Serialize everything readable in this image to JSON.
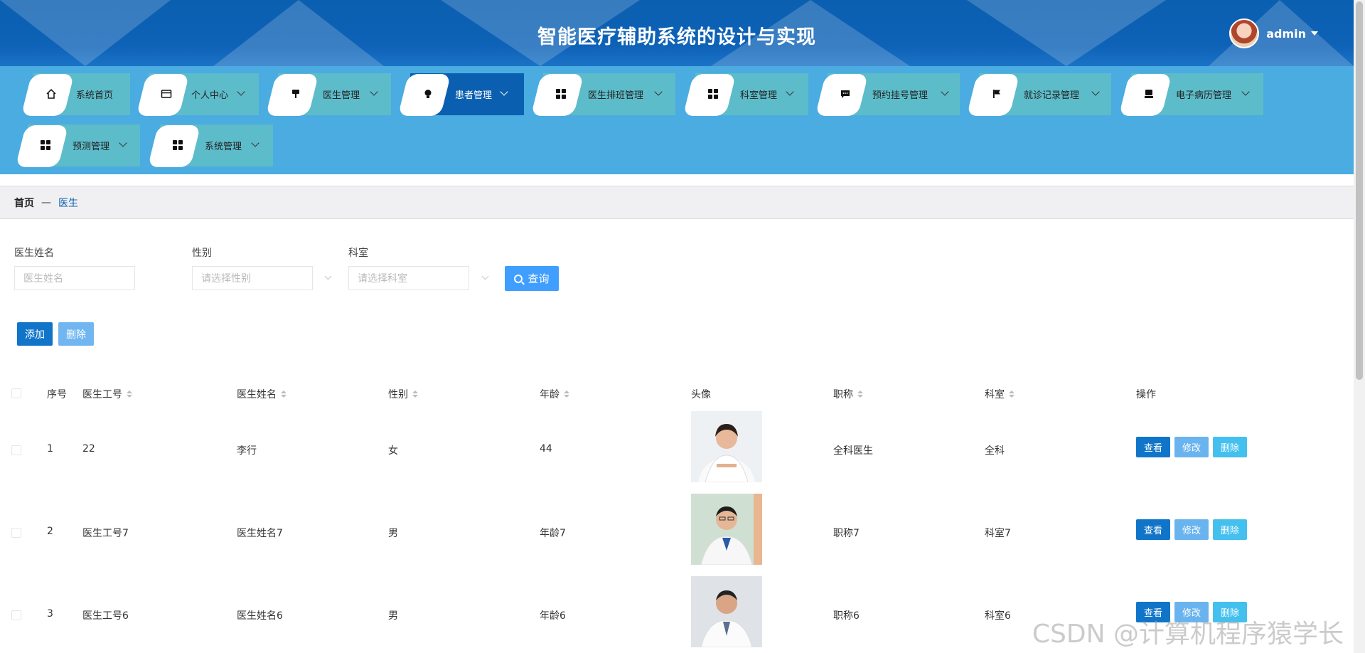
{
  "header": {
    "title": "智能医疗辅助系统的设计与实现",
    "username": "admin"
  },
  "nav": {
    "items": [
      {
        "label": "系统首页",
        "icon": "home-icon"
      },
      {
        "label": "个人中心",
        "icon": "card-icon"
      },
      {
        "label": "医生管理",
        "icon": "brush-icon"
      },
      {
        "label": "患者管理",
        "icon": "bulb-icon"
      },
      {
        "label": "医生排班管理",
        "icon": "grid-icon"
      },
      {
        "label": "科室管理",
        "icon": "grid-icon"
      },
      {
        "label": "预约挂号管理",
        "icon": "chat-icon"
      },
      {
        "label": "就诊记录管理",
        "icon": "flag-icon"
      },
      {
        "label": "电子病历管理",
        "icon": "printer-icon"
      },
      {
        "label": "预测管理",
        "icon": "grid-icon"
      },
      {
        "label": "系统管理",
        "icon": "grid-icon"
      }
    ]
  },
  "breadcrumb": {
    "home": "首页",
    "separator": "—",
    "current": "医生"
  },
  "search": {
    "name_label": "医生姓名",
    "name_placeholder": "医生姓名",
    "gender_label": "性别",
    "gender_placeholder": "请选择性别",
    "dept_label": "科室",
    "dept_placeholder": "请选择科室",
    "query_button": "查询"
  },
  "actions": {
    "add": "添加",
    "delete": "删除"
  },
  "table": {
    "columns": {
      "index": "序号",
      "doctor_id": "医生工号",
      "doctor_name": "医生姓名",
      "gender": "性别",
      "age": "年龄",
      "avatar": "头像",
      "title": "职称",
      "dept": "科室",
      "ops": "操作"
    },
    "rows": [
      {
        "index": "1",
        "doctor_id": "22",
        "doctor_name": "李行",
        "gender": "女",
        "age": "44",
        "title": "全科医生",
        "dept": "全科"
      },
      {
        "index": "2",
        "doctor_id": "医生工号7",
        "doctor_name": "医生姓名7",
        "gender": "男",
        "age": "年龄7",
        "title": "职称7",
        "dept": "科室7"
      },
      {
        "index": "3",
        "doctor_id": "医生工号6",
        "doctor_name": "医生姓名6",
        "gender": "男",
        "age": "年龄6",
        "title": "职称6",
        "dept": "科室6"
      }
    ],
    "row_buttons": {
      "view": "查看",
      "edit": "修改",
      "delete": "删除"
    }
  },
  "watermark": "CSDN @计算机程序猿学长",
  "colors": {
    "header": "#0b5fb0",
    "nav_bg": "#4aace0",
    "nav_item": "#5dbcca",
    "nav_active": "#0b5fb0",
    "primary": "#1075c9",
    "query": "#409eff"
  }
}
